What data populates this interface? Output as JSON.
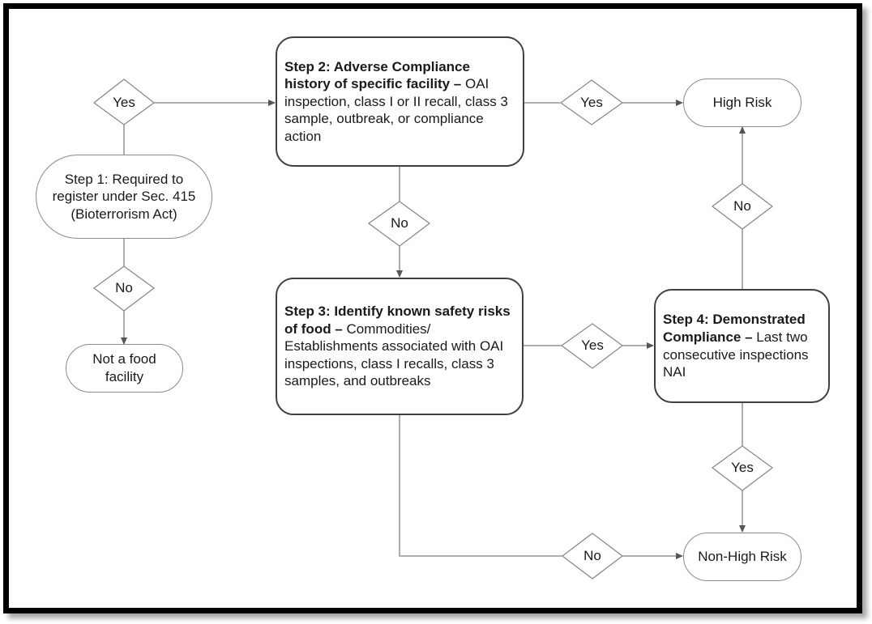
{
  "diagram": {
    "nodes": {
      "step1": {
        "text": "Step 1: Required to register under Sec. 415 (Bioterrorism Act)",
        "lines": [
          "Step 1: Required to",
          "register under Sec. 415",
          "(Bioterrorism Act)"
        ],
        "shape": "terminal"
      },
      "step2": {
        "bold": "Step 2: Adverse Compliance history of specific facility –",
        "text": " OAI inspection, class I or II recall, class 3 sample, outbreak, or compliance action",
        "shape": "process"
      },
      "step3": {
        "bold": "Step 3: Identify known safety risks of food –",
        "text": " Commodities/ Establishments associated with OAI inspections, class I recalls, class 3 samples, and outbreaks",
        "shape": "process"
      },
      "step4": {
        "bold": "Step 4: Demonstrated Compliance –",
        "text": " Last two consecutive inspections NAI",
        "shape": "process"
      },
      "not_food": {
        "lines": [
          "Not a food",
          "facility"
        ],
        "shape": "terminal"
      },
      "high_risk": {
        "text": "High Risk",
        "shape": "terminal"
      },
      "non_high_risk": {
        "text": "Non-High Risk",
        "shape": "terminal"
      }
    },
    "decisions": {
      "d_step1_yes": "Yes",
      "d_step1_no": "No",
      "d_step2_yes": "Yes",
      "d_step2_no": "No",
      "d_step3_yes": "Yes",
      "d_step3_no": "No",
      "d_step4_no": "No",
      "d_step4_yes": "Yes"
    },
    "edges": [
      {
        "from": "step1",
        "via": "d_step1_yes",
        "to": "step2"
      },
      {
        "from": "step1",
        "via": "d_step1_no",
        "to": "not_food"
      },
      {
        "from": "step2",
        "via": "d_step2_yes",
        "to": "high_risk"
      },
      {
        "from": "step2",
        "via": "d_step2_no",
        "to": "step3"
      },
      {
        "from": "step3",
        "via": "d_step3_yes",
        "to": "step4"
      },
      {
        "from": "step3",
        "via": "d_step3_no",
        "to": "non_high_risk"
      },
      {
        "from": "step4",
        "via": "d_step4_no",
        "to": "high_risk"
      },
      {
        "from": "step4",
        "via": "d_step4_yes",
        "to": "non_high_risk"
      }
    ],
    "colors": {
      "line": "#7f7f7f",
      "process_border": "#404040",
      "frame": "#000000"
    }
  }
}
